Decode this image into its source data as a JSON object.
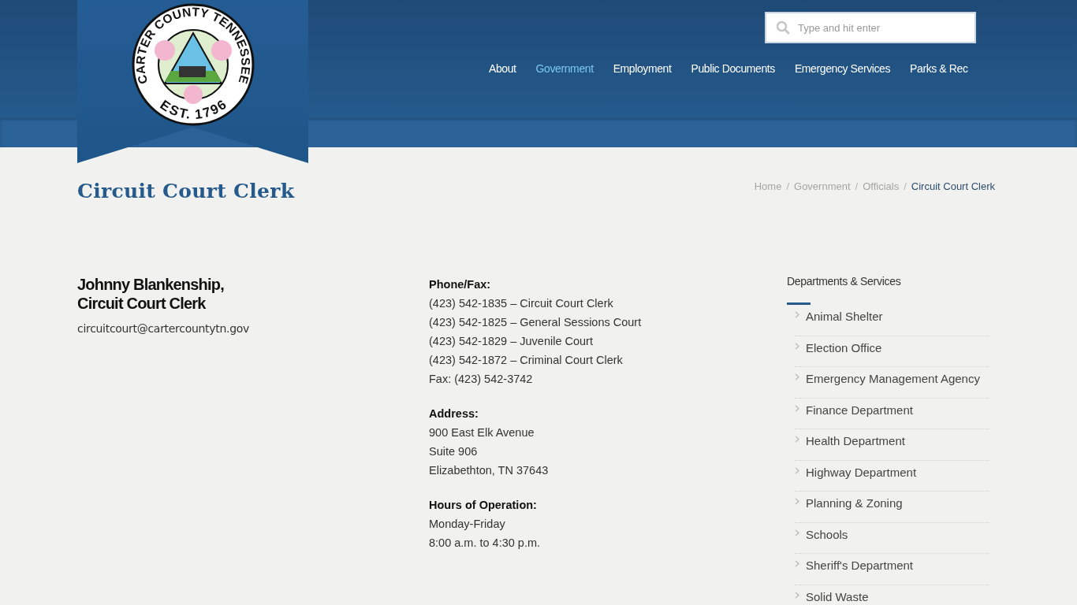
{
  "logo": {
    "top_text": "CARTER COUNTY TENNESSEE",
    "bottom_text": "EST. 1796"
  },
  "search": {
    "placeholder": "Type and hit enter"
  },
  "nav": [
    {
      "label": "About",
      "selected": false
    },
    {
      "label": "Government",
      "selected": true
    },
    {
      "label": "Employment",
      "selected": false
    },
    {
      "label": "Public Documents",
      "selected": false
    },
    {
      "label": "Emergency Services",
      "selected": false
    },
    {
      "label": "Parks & Rec",
      "selected": false
    }
  ],
  "page_title": "Circuit Court Clerk",
  "breadcrumb": [
    {
      "label": "Home",
      "current": false
    },
    {
      "label": "Government",
      "current": false
    },
    {
      "label": "Officials",
      "current": false
    },
    {
      "label": "Circuit Court Clerk",
      "current": true
    }
  ],
  "breadcrumb_separator": "/",
  "official": {
    "name_lines": [
      "Johnny Blankenship,",
      "Circuit Court Clerk"
    ],
    "email": "circuitcourt@cartercountytn.gov"
  },
  "contact": [
    {
      "heading": "Phone/Fax:",
      "lines": [
        "(423) 542-1835 – Circuit Court Clerk",
        "(423) 542-1825 – General Sessions Court",
        "(423) 542-1829 – Juvenile Court",
        "(423) 542-1872 – Criminal Court Clerk",
        "Fax: (423) 542-3742"
      ]
    },
    {
      "heading": "Address:",
      "lines": [
        "900 East Elk Avenue",
        "Suite 906",
        "Elizabethton, TN 37643"
      ]
    },
    {
      "heading": "Hours of Operation:",
      "lines": [
        "Monday-Friday",
        "8:00 a.m. to 4:30 p.m."
      ]
    }
  ],
  "sidebar": {
    "title": "Departments & Services",
    "items": [
      "Animal Shelter",
      "Election Office",
      "Emergency Management Agency",
      "Finance Department",
      "Health Department",
      "Highway Department",
      "Planning & Zoning",
      "Schools",
      "Sheriff's Department",
      "Solid Waste"
    ]
  }
}
